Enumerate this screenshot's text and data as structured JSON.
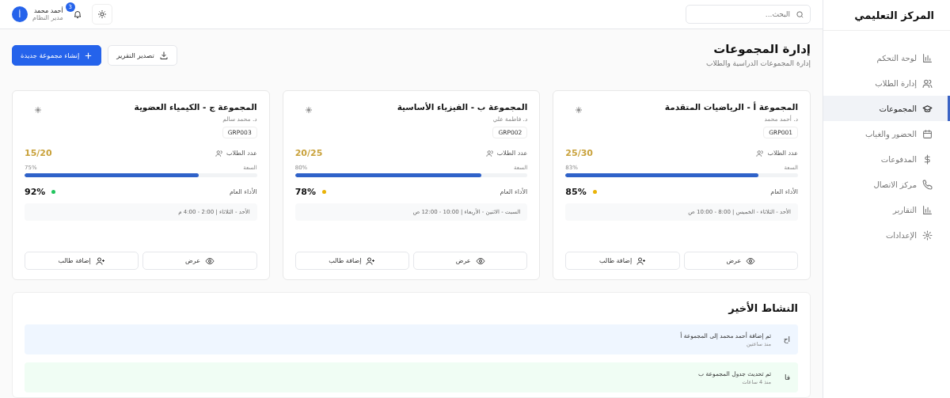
{
  "sidebar": {
    "title": "المركز التعليمي",
    "items": [
      {
        "label": "لوحة التحكم",
        "selected": false
      },
      {
        "label": "إدارة الطلاب",
        "selected": false
      },
      {
        "label": "المجموعات",
        "selected": true
      },
      {
        "label": "الحضور والغياب",
        "selected": false
      },
      {
        "label": "المدفوعات",
        "selected": false
      },
      {
        "label": "مركز الاتصال",
        "selected": false
      },
      {
        "label": "التقارير",
        "selected": false
      },
      {
        "label": "الإعدادات",
        "selected": false
      }
    ]
  },
  "header": {
    "search": {
      "placeholder": "البحث..."
    },
    "notifications": "3",
    "user": {
      "avatar": "أ",
      "name": "أحمد محمد",
      "role": "مدير النظام"
    }
  },
  "page": {
    "title": "إدارة المجموعات",
    "subtitle": "إدارة المجموعات الدراسية والطلاب",
    "export_button": "تصدير التقرير",
    "create_button": "إنشاء مجموعة جديدة"
  },
  "groups": [
    {
      "name": "المجموعة أ - الرياضيات المتقدمة",
      "teacher": "د. أحمد محمد",
      "code": "GRP001",
      "students_label": "عدد الطلاب",
      "count": "25/30",
      "capacity_label": "السعة",
      "capacity": "83%",
      "level": 0.83,
      "performance_label": "الأداء العام",
      "performance": "85%",
      "color": "#eab308",
      "schedule": "الأحد - الثلاثاء - الخميس | 8:00 - 10:00 ص",
      "view": "عرض",
      "add": "إضافة طالب"
    },
    {
      "name": "المجموعة ب - الفيزياء الأساسية",
      "teacher": "د. فاطمة علي",
      "code": "GRP002",
      "students_label": "عدد الطلاب",
      "count": "20/25",
      "capacity_label": "السعة",
      "capacity": "80%",
      "level": 0.8,
      "performance_label": "الأداء العام",
      "performance": "78%",
      "color": "#eab308",
      "schedule": "السبت - الاثنين - الأربعاء | 10:00 - 12:00 ص",
      "view": "عرض",
      "add": "إضافة طالب"
    },
    {
      "name": "المجموعة ج - الكيمياء العضوية",
      "teacher": "د. محمد سالم",
      "code": "GRP003",
      "students_label": "عدد الطلاب",
      "count": "15/20",
      "capacity_label": "السعة",
      "capacity": "75%",
      "level": 0.75,
      "performance_label": "الأداء العام",
      "performance": "92%",
      "color": "#22c55e",
      "schedule": "الأحد - الثلاثاء | 2:00 - 4:00 م",
      "view": "عرض",
      "add": "إضافة طالب"
    }
  ],
  "activity": {
    "title": "النشاط الأخير",
    "items": [
      {
        "initials": "اح",
        "text": "تم إضافة أحمد محمد إلى المجموعة أ",
        "time": "منذ ساعتين",
        "color": "#eff6ff"
      },
      {
        "initials": "فا",
        "text": "تم تحديث جدول المجموعة ب",
        "time": "منذ 4 ساعات",
        "color": "#f0fdf4"
      }
    ]
  }
}
